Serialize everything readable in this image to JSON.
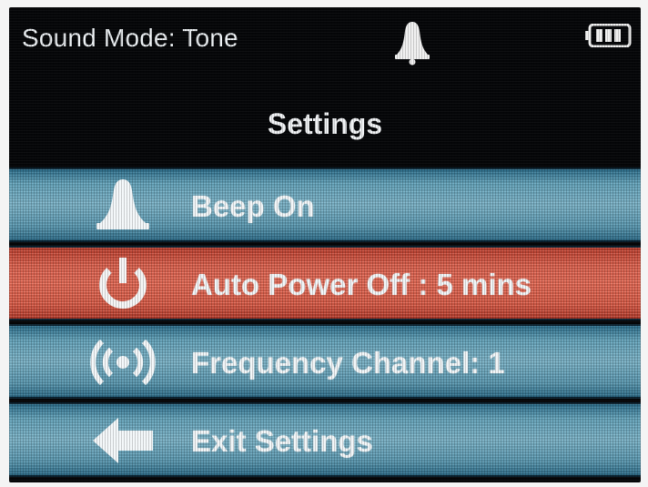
{
  "status_bar": {
    "sound_mode_label": "Sound Mode: Tone",
    "bell_icon": "bell-icon",
    "battery_icon": "battery-icon"
  },
  "title": "Settings",
  "menu": {
    "items": [
      {
        "label": "Beep On",
        "icon": "bell-icon",
        "selected": false
      },
      {
        "label": "Auto Power Off : 5 mins",
        "icon": "power-icon",
        "selected": true
      },
      {
        "label": "Frequency Channel: 1",
        "icon": "wireless-signal-icon",
        "selected": false
      },
      {
        "label": "Exit Settings",
        "icon": "arrow-left-icon",
        "selected": false
      }
    ]
  },
  "colors": {
    "background": "#050608",
    "item_blue": "#6fb0c6",
    "item_selected_red": "#e6614c",
    "text": "#f3f7f9"
  }
}
